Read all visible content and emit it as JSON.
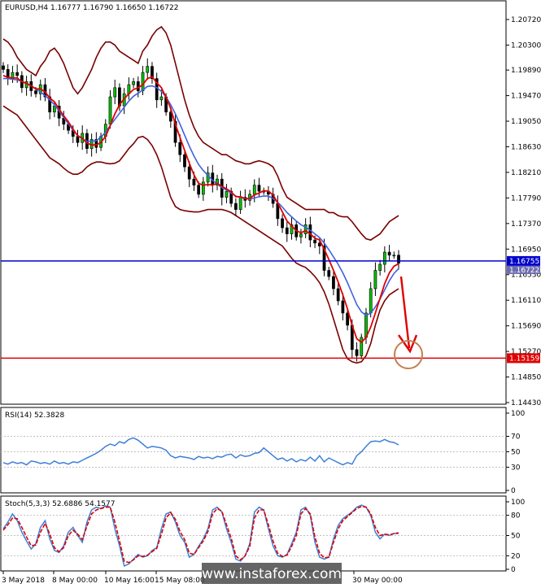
{
  "main": {
    "header": "EURUSD,H4  1.16777 1.16790 1.16650 1.16722",
    "ylim": [
      1.1443,
      1.21
    ],
    "y_ticks": [
      "1.20720",
      "1.20300",
      "1.19890",
      "1.19470",
      "1.19050",
      "1.18630",
      "1.18210",
      "1.17790",
      "1.17370",
      "1.16950",
      "1.16530",
      "1.16110",
      "1.15690",
      "1.15270",
      "1.14850",
      "1.14430"
    ],
    "current_price": "1.16755",
    "current_price_sub": "1.16722",
    "target_price": "1.15159",
    "colors": {
      "current_line": "#0000cc",
      "target_line": "#e00000",
      "bull": "#00c000",
      "bear": "#000000",
      "bands": "#7a0000",
      "ma_fast": "#e00000",
      "ma_slow": "#4060e0",
      "arrow": "#e00000",
      "circle": "#c08050"
    }
  },
  "rsi": {
    "header": "RSI(14) 52.3828",
    "ylim": [
      0,
      100
    ],
    "y_ticks": [
      "100",
      "70",
      "50",
      "30",
      "0"
    ],
    "levels": [
      70,
      50,
      30
    ]
  },
  "stoch": {
    "header": "Stoch(5,3,3) 52.6886 54.1577",
    "ylim": [
      0,
      100
    ],
    "y_ticks": [
      "100",
      "80",
      "50",
      "20",
      "0"
    ],
    "levels": [
      80,
      50,
      20
    ]
  },
  "x_labels": [
    "3 May 2018",
    "8 May 00:00",
    "10 May 16:00",
    "15 May 08:00",
    "30 May 00:00"
  ],
  "watermark": "www.instaforex.com",
  "chart_data": [
    {
      "type": "candlestick",
      "title": "EURUSD,H4",
      "y_axis": [
        1.1443,
        1.21
      ],
      "close": [
        1.199,
        1.1975,
        1.1985,
        1.198,
        1.196,
        1.197,
        1.1955,
        1.195,
        1.1965,
        1.1945,
        1.192,
        1.193,
        1.191,
        1.19,
        1.189,
        1.188,
        1.187,
        1.1885,
        1.186,
        1.1875,
        1.1862,
        1.188,
        1.19,
        1.1945,
        1.196,
        1.193,
        1.195,
        1.1965,
        1.197,
        1.1955,
        1.1985,
        1.1995,
        1.1975,
        1.194,
        1.1945,
        1.192,
        1.1905,
        1.187,
        1.185,
        1.183,
        1.181,
        1.18,
        1.1785,
        1.1805,
        1.182,
        1.18,
        1.181,
        1.178,
        1.179,
        1.177,
        1.176,
        1.178,
        1.1775,
        1.1785,
        1.18,
        1.179,
        1.179,
        1.1785,
        1.177,
        1.1745,
        1.173,
        1.172,
        1.1735,
        1.1715,
        1.172,
        1.1735,
        1.171,
        1.1705,
        1.17,
        1.166,
        1.165,
        1.163,
        1.161,
        1.159,
        1.157,
        1.153,
        1.152,
        1.155,
        1.159,
        1.163,
        1.166,
        1.167,
        1.169,
        1.1685,
        1.1685,
        1.1672
      ],
      "ma_fast": [
        1.198,
        1.1977,
        1.1976,
        1.1976,
        1.197,
        1.1967,
        1.1963,
        1.1958,
        1.1958,
        1.1953,
        1.1943,
        1.1937,
        1.1925,
        1.1914,
        1.1904,
        1.1892,
        1.1881,
        1.1877,
        1.1869,
        1.1866,
        1.1866,
        1.187,
        1.188,
        1.1898,
        1.1917,
        1.1932,
        1.1942,
        1.195,
        1.1957,
        1.196,
        1.1965,
        1.1975,
        1.1978,
        1.1968,
        1.196,
        1.1944,
        1.1926,
        1.19,
        1.1878,
        1.1857,
        1.1836,
        1.1817,
        1.1803,
        1.18,
        1.1801,
        1.18,
        1.1803,
        1.1798,
        1.1794,
        1.1789,
        1.1781,
        1.1781,
        1.1778,
        1.1778,
        1.1784,
        1.1787,
        1.1791,
        1.179,
        1.1784,
        1.1771,
        1.1756,
        1.1741,
        1.1733,
        1.1725,
        1.1722,
        1.1725,
        1.172,
        1.1713,
        1.171,
        1.1695,
        1.1678,
        1.166,
        1.1641,
        1.162,
        1.1597,
        1.157,
        1.1548,
        1.1542,
        1.155,
        1.1567,
        1.159,
        1.1614,
        1.1638,
        1.1656,
        1.1667,
        1.1671
      ],
      "ma_slow": [
        1.1975,
        1.1975,
        1.1974,
        1.1973,
        1.197,
        1.1967,
        1.1963,
        1.1958,
        1.1953,
        1.1947,
        1.194,
        1.1932,
        1.1922,
        1.1911,
        1.1901,
        1.189,
        1.1882,
        1.1876,
        1.1872,
        1.1872,
        1.1873,
        1.1879,
        1.1887,
        1.1898,
        1.1908,
        1.1918,
        1.1928,
        1.1938,
        1.1946,
        1.1951,
        1.1956,
        1.1962,
        1.1963,
        1.196,
        1.1954,
        1.1945,
        1.1932,
        1.1917,
        1.19,
        1.1882,
        1.1864,
        1.1848,
        1.1834,
        1.1824,
        1.1816,
        1.1808,
        1.1802,
        1.1796,
        1.1792,
        1.1787,
        1.1782,
        1.178,
        1.1778,
        1.1777,
        1.1779,
        1.1781,
        1.1782,
        1.1782,
        1.1778,
        1.1772,
        1.1764,
        1.1755,
        1.1748,
        1.1741,
        1.1735,
        1.1731,
        1.1726,
        1.172,
        1.1714,
        1.1705,
        1.1694,
        1.1682,
        1.167,
        1.1656,
        1.164,
        1.1622,
        1.1604,
        1.1592,
        1.1586,
        1.159,
        1.16,
        1.1613,
        1.1628,
        1.1643,
        1.1655,
        1.1663
      ],
      "upper_band": [
        1.204,
        1.2035,
        1.2025,
        1.201,
        1.2,
        1.199,
        1.1985,
        1.198,
        1.1995,
        1.2005,
        1.202,
        1.2025,
        1.2015,
        1.2,
        1.198,
        1.196,
        1.195,
        1.196,
        1.1975,
        1.199,
        1.201,
        1.2025,
        1.2035,
        1.2035,
        1.203,
        1.202,
        1.2015,
        1.201,
        1.2005,
        1.2,
        1.202,
        1.203,
        1.2045,
        1.2055,
        1.206,
        1.205,
        1.203,
        1.2,
        1.197,
        1.194,
        1.1915,
        1.1895,
        1.188,
        1.187,
        1.1865,
        1.186,
        1.1855,
        1.185,
        1.185,
        1.1845,
        1.184,
        1.1838,
        1.1835,
        1.1835,
        1.1838,
        1.184,
        1.1838,
        1.1835,
        1.183,
        1.1815,
        1.1795,
        1.178,
        1.1775,
        1.177,
        1.1765,
        1.176,
        1.176,
        1.176,
        1.176,
        1.176,
        1.1755,
        1.1755,
        1.175,
        1.1748,
        1.1748,
        1.174,
        1.173,
        1.172,
        1.1712,
        1.171,
        1.1715,
        1.172,
        1.173,
        1.174,
        1.1745,
        1.175
      ],
      "lower_band": [
        1.193,
        1.1925,
        1.192,
        1.1915,
        1.1905,
        1.1895,
        1.1885,
        1.1875,
        1.1865,
        1.1855,
        1.1845,
        1.184,
        1.1835,
        1.1828,
        1.1822,
        1.1818,
        1.1818,
        1.1822,
        1.183,
        1.1835,
        1.1838,
        1.1838,
        1.1836,
        1.1835,
        1.1836,
        1.184,
        1.185,
        1.186,
        1.1868,
        1.1878,
        1.188,
        1.1875,
        1.1865,
        1.185,
        1.183,
        1.1805,
        1.178,
        1.1765,
        1.176,
        1.1758,
        1.1757,
        1.1756,
        1.1756,
        1.1758,
        1.176,
        1.176,
        1.176,
        1.176,
        1.1758,
        1.1755,
        1.175,
        1.1745,
        1.174,
        1.1735,
        1.173,
        1.1725,
        1.172,
        1.1715,
        1.171,
        1.1705,
        1.17,
        1.169,
        1.168,
        1.1672,
        1.1668,
        1.1665,
        1.1658,
        1.165,
        1.164,
        1.1625,
        1.1605,
        1.158,
        1.1555,
        1.153,
        1.1515,
        1.151,
        1.1508,
        1.151,
        1.152,
        1.154,
        1.157,
        1.1595,
        1.161,
        1.162,
        1.1625,
        1.163
      ],
      "horizontal_lines": [
        {
          "label": "1.16755",
          "value": 1.16755
        },
        {
          "label": "1.15159",
          "value": 1.15159
        }
      ]
    },
    {
      "type": "line",
      "title": "RSI(14) 52.3828",
      "y_axis": [
        0,
        100
      ],
      "values": [
        36,
        34,
        37,
        35,
        36,
        33,
        38,
        37,
        35,
        36,
        34,
        38,
        35,
        36,
        34,
        37,
        36,
        39,
        42,
        45,
        48,
        52,
        57,
        60,
        58,
        63,
        61,
        66,
        68,
        65,
        60,
        55,
        57,
        56,
        55,
        52,
        45,
        42,
        44,
        43,
        42,
        40,
        44,
        42,
        43,
        41,
        44,
        43,
        46,
        47,
        42,
        46,
        44,
        45,
        48,
        49,
        55,
        50,
        45,
        40,
        42,
        38,
        41,
        37,
        40,
        38,
        43,
        38,
        45,
        37,
        42,
        39,
        36,
        33,
        36,
        34,
        45,
        50,
        57,
        63,
        64,
        63,
        66,
        63,
        62,
        59
      ]
    },
    {
      "type": "line",
      "title": "Stoch(5,3,3) 52.6886 54.1577",
      "y_axis": [
        0,
        100
      ],
      "series": [
        {
          "name": "main",
          "values": [
            60,
            70,
            82,
            72,
            55,
            42,
            30,
            38,
            62,
            72,
            45,
            28,
            25,
            35,
            55,
            62,
            50,
            40,
            70,
            88,
            92,
            90,
            94,
            92,
            60,
            35,
            5,
            8,
            15,
            22,
            18,
            20,
            28,
            32,
            60,
            82,
            85,
            70,
            50,
            40,
            18,
            22,
            34,
            45,
            60,
            88,
            92,
            85,
            60,
            40,
            15,
            12,
            20,
            38,
            85,
            92,
            88,
            60,
            35,
            20,
            18,
            22,
            38,
            55,
            88,
            92,
            80,
            40,
            18,
            15,
            18,
            45,
            65,
            75,
            80,
            85,
            92,
            95,
            92,
            80,
            55,
            45,
            52,
            50,
            53,
            53
          ]
        },
        {
          "name": "signal",
          "values": [
            58,
            66,
            76,
            75,
            62,
            48,
            35,
            36,
            55,
            68,
            52,
            32,
            26,
            32,
            50,
            58,
            52,
            44,
            64,
            82,
            88,
            90,
            92,
            92,
            70,
            42,
            12,
            10,
            14,
            20,
            19,
            21,
            26,
            31,
            52,
            76,
            84,
            74,
            56,
            44,
            24,
            22,
            32,
            42,
            56,
            82,
            90,
            86,
            66,
            46,
            20,
            14,
            20,
            34,
            76,
            88,
            88,
            66,
            42,
            24,
            19,
            21,
            34,
            50,
            82,
            90,
            82,
            48,
            24,
            17,
            18,
            40,
            60,
            72,
            78,
            84,
            90,
            93,
            92,
            82,
            62,
            50,
            52,
            51,
            53,
            54
          ]
        }
      ]
    }
  ]
}
